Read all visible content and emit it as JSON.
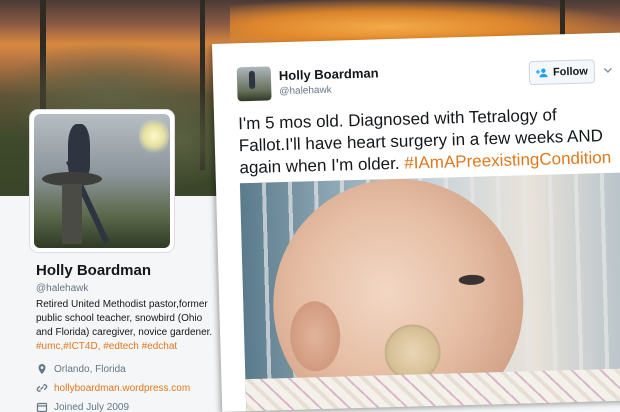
{
  "profile": {
    "name": "Holly Boardman",
    "handle": "@halehawk",
    "bio_text": "Retired United Methodist pastor,former public school teacher, snowbird (Ohio and Florida) caregiver, novice gardener.",
    "bio_tags": "#umc,#ICT4D, #edtech #edchat",
    "location": "Orlando, Florida",
    "website": "hollyboardman.wordpress.com",
    "joined": "Joined July 2009",
    "icons": {
      "location": "map-pin-icon",
      "website": "link-icon",
      "joined": "calendar-icon"
    }
  },
  "tweet": {
    "author_name": "Holly Boardman",
    "author_handle": "@halehawk",
    "follow_label": "Follow",
    "text": "I'm 5 mos old. Diagnosed with Tetralogy of Fallot.I'll have heart surgery in a few weeks AND again when I'm older.",
    "hashtag": "#IAmAPreexistingCondition",
    "icons": {
      "follow": "add-user-icon",
      "menu": "chevron-down-icon"
    }
  },
  "colors": {
    "accent": "#e0781e",
    "text": "#14171a",
    "muted": "#657786"
  }
}
